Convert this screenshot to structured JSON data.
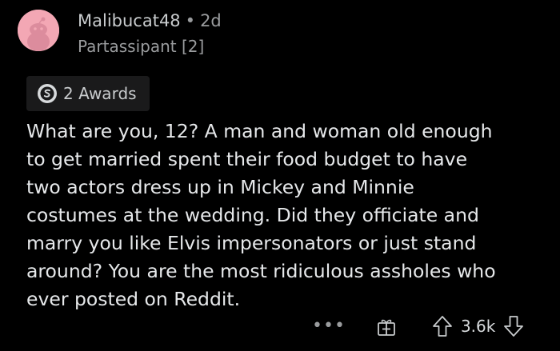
{
  "comment": {
    "author": "Malibucat48",
    "separator": "•",
    "age": "2d",
    "flair": "Partassipant [2]",
    "awards_label": "2 Awards",
    "body_lines": [
      "What are you, 12? A man and woman old enough",
      "to get married spent their food budget to have",
      "two actors dress up in Mickey and Minnie",
      "costumes at the wedding. Did they officiate and",
      "marry you like Elvis impersonators or just stand",
      "around? You are the most ridiculous assholes who",
      "ever posted on Reddit."
    ],
    "more_label": "•••",
    "score": "3.6k"
  },
  "icons": {
    "avatar": "snoo-avatar-icon",
    "award": "silver-award-icon",
    "gift": "gift-icon",
    "upvote": "upvote-arrow-icon",
    "downvote": "downvote-arrow-icon"
  },
  "colors": {
    "background": "#000000",
    "avatar_bg": "#f3a7b4",
    "text": "#e6e8ea",
    "muted": "#9a9c9e",
    "award_chip": "#1a1a1b"
  }
}
